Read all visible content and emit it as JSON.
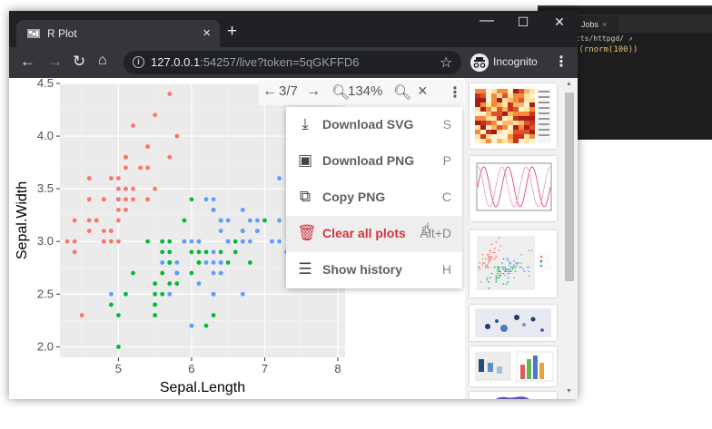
{
  "ide": {
    "tab_label": "Jobs",
    "path_text": "cts/httpgd/",
    "code_text": ":(rnorm(100))"
  },
  "browser": {
    "tab_title": "R Plot",
    "url_host": "127.0.0.1",
    "url_rest": ":54257/live?token=5qGKFFD6",
    "incognito_label": "Incognito"
  },
  "plot_toolbar": {
    "page_count": "3/7",
    "zoom": "134%"
  },
  "menu": {
    "items": [
      {
        "label": "Download SVG",
        "shortcut": "S",
        "icon": "download-icon"
      },
      {
        "label": "Download PNG",
        "shortcut": "P",
        "icon": "image-icon"
      },
      {
        "label": "Copy PNG",
        "shortcut": "C",
        "icon": "copy-icon"
      },
      {
        "label": "Clear all plots",
        "shortcut": "Alt+D",
        "icon": "trash-icon"
      },
      {
        "label": "Show history",
        "shortcut": "H",
        "icon": "list-icon"
      }
    ]
  },
  "colors": {
    "setosa": "#f8766d",
    "versicolor": "#00ba38",
    "virginica": "#619cff",
    "panel_bg": "#ebebeb",
    "danger": "#d03442"
  },
  "chart_data": {
    "type": "scatter",
    "xlabel": "Sepal.Length",
    "ylabel": "Sepal.Width",
    "xlim": [
      4.2,
      8.1
    ],
    "ylim": [
      1.9,
      4.5
    ],
    "xticks": [
      5,
      6,
      7,
      8
    ],
    "yticks": [
      2.0,
      2.5,
      3.0,
      3.5,
      4.0,
      4.5
    ],
    "grid": true,
    "series": [
      {
        "key": "setosa",
        "points": [
          [
            5.1,
            3.5
          ],
          [
            4.9,
            3.0
          ],
          [
            4.7,
            3.2
          ],
          [
            4.6,
            3.1
          ],
          [
            5.0,
            3.6
          ],
          [
            5.4,
            3.9
          ],
          [
            4.6,
            3.4
          ],
          [
            5.0,
            3.4
          ],
          [
            4.4,
            2.9
          ],
          [
            4.9,
            3.1
          ],
          [
            5.4,
            3.7
          ],
          [
            4.8,
            3.4
          ],
          [
            4.8,
            3.0
          ],
          [
            4.3,
            3.0
          ],
          [
            5.8,
            4.0
          ],
          [
            5.7,
            4.4
          ],
          [
            5.4,
            3.9
          ],
          [
            5.1,
            3.5
          ],
          [
            5.7,
            3.8
          ],
          [
            5.1,
            3.8
          ],
          [
            5.4,
            3.4
          ],
          [
            5.1,
            3.7
          ],
          [
            4.6,
            3.6
          ],
          [
            5.1,
            3.3
          ],
          [
            4.8,
            3.4
          ],
          [
            5.0,
            3.0
          ],
          [
            5.0,
            3.4
          ],
          [
            5.2,
            3.5
          ],
          [
            5.2,
            3.4
          ],
          [
            4.7,
            3.2
          ],
          [
            4.8,
            3.1
          ],
          [
            5.4,
            3.4
          ],
          [
            5.2,
            4.1
          ],
          [
            5.5,
            4.2
          ],
          [
            4.9,
            3.1
          ],
          [
            5.0,
            3.2
          ],
          [
            5.5,
            3.5
          ],
          [
            4.9,
            3.6
          ],
          [
            4.4,
            3.0
          ],
          [
            5.1,
            3.4
          ],
          [
            5.0,
            3.5
          ],
          [
            4.5,
            2.3
          ],
          [
            4.4,
            3.2
          ],
          [
            5.0,
            3.5
          ],
          [
            5.1,
            3.8
          ],
          [
            4.8,
            3.0
          ],
          [
            5.1,
            3.8
          ],
          [
            4.6,
            3.2
          ],
          [
            5.3,
            3.7
          ],
          [
            5.0,
            3.3
          ]
        ]
      },
      {
        "key": "versicolor",
        "points": [
          [
            7.0,
            3.2
          ],
          [
            6.4,
            3.2
          ],
          [
            6.9,
            3.1
          ],
          [
            5.5,
            2.3
          ],
          [
            6.5,
            2.8
          ],
          [
            5.7,
            2.8
          ],
          [
            6.3,
            3.3
          ],
          [
            4.9,
            2.4
          ],
          [
            6.6,
            2.9
          ],
          [
            5.2,
            2.7
          ],
          [
            5.0,
            2.0
          ],
          [
            5.9,
            3.0
          ],
          [
            6.0,
            2.2
          ],
          [
            6.1,
            2.9
          ],
          [
            5.6,
            2.9
          ],
          [
            6.7,
            3.1
          ],
          [
            5.6,
            3.0
          ],
          [
            5.8,
            2.7
          ],
          [
            6.2,
            2.2
          ],
          [
            5.6,
            2.5
          ],
          [
            5.9,
            3.2
          ],
          [
            6.1,
            2.8
          ],
          [
            6.3,
            2.5
          ],
          [
            6.1,
            2.8
          ],
          [
            6.4,
            2.9
          ],
          [
            6.6,
            3.0
          ],
          [
            6.8,
            2.8
          ],
          [
            6.7,
            3.0
          ],
          [
            6.0,
            2.9
          ],
          [
            5.7,
            2.6
          ],
          [
            5.5,
            2.4
          ],
          [
            5.5,
            2.4
          ],
          [
            5.8,
            2.7
          ],
          [
            6.0,
            2.7
          ],
          [
            5.4,
            3.0
          ],
          [
            6.0,
            3.4
          ],
          [
            6.7,
            3.1
          ],
          [
            6.3,
            2.3
          ],
          [
            5.6,
            3.0
          ],
          [
            5.5,
            2.5
          ],
          [
            5.5,
            2.6
          ],
          [
            6.1,
            3.0
          ],
          [
            5.8,
            2.6
          ],
          [
            5.0,
            2.3
          ],
          [
            5.6,
            2.7
          ],
          [
            5.7,
            3.0
          ],
          [
            5.7,
            2.9
          ],
          [
            6.2,
            2.9
          ],
          [
            5.1,
            2.5
          ],
          [
            5.7,
            2.8
          ]
        ]
      },
      {
        "key": "virginica",
        "points": [
          [
            6.3,
            3.3
          ],
          [
            5.8,
            2.7
          ],
          [
            7.1,
            3.0
          ],
          [
            6.3,
            2.9
          ],
          [
            6.5,
            3.0
          ],
          [
            7.6,
            3.0
          ],
          [
            4.9,
            2.5
          ],
          [
            7.3,
            2.9
          ],
          [
            6.7,
            2.5
          ],
          [
            7.2,
            3.6
          ],
          [
            6.5,
            3.2
          ],
          [
            6.4,
            2.7
          ],
          [
            6.8,
            3.0
          ],
          [
            5.7,
            2.5
          ],
          [
            5.8,
            2.8
          ],
          [
            6.4,
            3.2
          ],
          [
            6.5,
            3.0
          ],
          [
            7.7,
            3.8
          ],
          [
            7.7,
            2.6
          ],
          [
            6.0,
            2.2
          ],
          [
            6.9,
            3.2
          ],
          [
            5.6,
            2.8
          ],
          [
            7.7,
            2.8
          ],
          [
            6.3,
            2.7
          ],
          [
            6.7,
            3.3
          ],
          [
            7.2,
            3.2
          ],
          [
            6.2,
            2.8
          ],
          [
            6.1,
            3.0
          ],
          [
            6.4,
            2.8
          ],
          [
            7.2,
            3.0
          ],
          [
            7.4,
            2.8
          ],
          [
            7.9,
            3.8
          ],
          [
            6.4,
            2.8
          ],
          [
            6.3,
            2.8
          ],
          [
            6.1,
            2.6
          ],
          [
            7.7,
            3.0
          ],
          [
            6.3,
            3.4
          ],
          [
            6.4,
            3.1
          ],
          [
            6.0,
            3.0
          ],
          [
            6.9,
            3.1
          ],
          [
            6.7,
            3.1
          ],
          [
            6.9,
            3.1
          ],
          [
            5.8,
            2.7
          ],
          [
            6.8,
            3.2
          ],
          [
            6.7,
            3.3
          ],
          [
            6.7,
            3.0
          ],
          [
            6.3,
            2.5
          ],
          [
            6.5,
            3.0
          ],
          [
            6.2,
            3.4
          ],
          [
            5.9,
            3.0
          ]
        ]
      }
    ]
  }
}
